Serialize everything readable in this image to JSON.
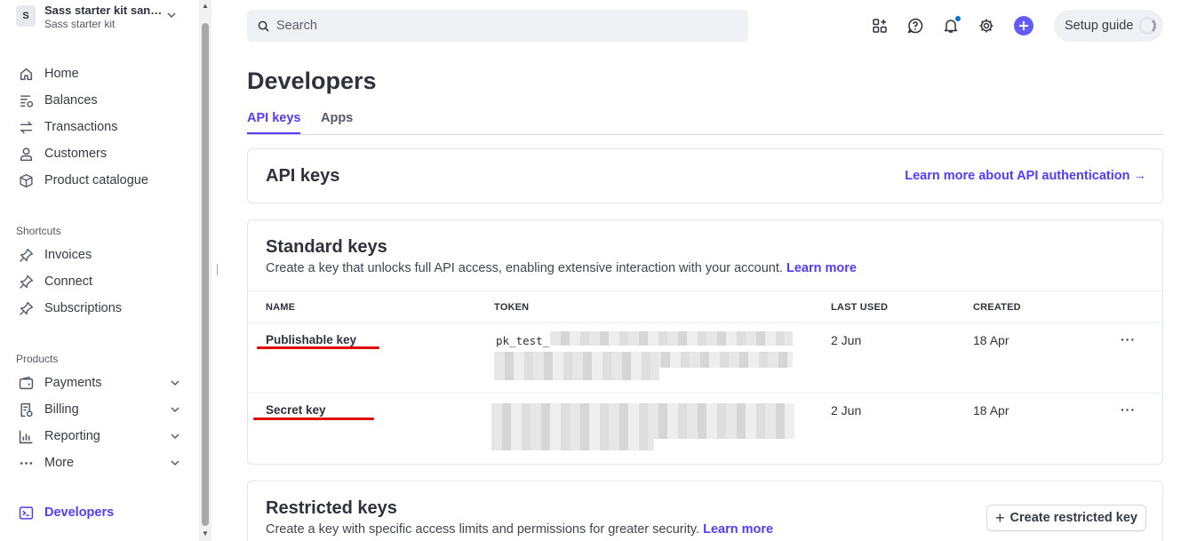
{
  "account": {
    "avatar": "S",
    "name": "Sass starter kit sand…",
    "subtitle": "Sass starter kit"
  },
  "nav": {
    "main": [
      {
        "label": "Home",
        "icon": "home-icon"
      },
      {
        "label": "Balances",
        "icon": "balances-icon"
      },
      {
        "label": "Transactions",
        "icon": "transactions-icon"
      },
      {
        "label": "Customers",
        "icon": "customers-icon"
      },
      {
        "label": "Product catalogue",
        "icon": "product-icon"
      }
    ],
    "shortcuts_label": "Shortcuts",
    "shortcuts": [
      {
        "label": "Invoices",
        "icon": "pin-icon"
      },
      {
        "label": "Connect",
        "icon": "pin-icon"
      },
      {
        "label": "Subscriptions",
        "icon": "pin-icon"
      }
    ],
    "products_label": "Products",
    "products": [
      {
        "label": "Payments",
        "icon": "payments-icon"
      },
      {
        "label": "Billing",
        "icon": "billing-icon"
      },
      {
        "label": "Reporting",
        "icon": "reporting-icon"
      },
      {
        "label": "More",
        "icon": "more-icon"
      }
    ],
    "developers": {
      "label": "Developers",
      "icon": "developers-icon"
    }
  },
  "search": {
    "placeholder": "Search"
  },
  "topbar": {
    "setup_label": "Setup guide",
    "accent": "#635bff"
  },
  "page": {
    "title": "Developers",
    "tabs": [
      {
        "label": "API keys",
        "active": true
      },
      {
        "label": "Apps",
        "active": false
      }
    ]
  },
  "api_keys_card": {
    "title": "API keys",
    "link": "Learn more about API authentication →"
  },
  "standard_keys": {
    "title": "Standard keys",
    "description": "Create a key that unlocks full API access, enabling extensive interaction with your account.",
    "learn_more": "Learn more",
    "columns": [
      "NAME",
      "TOKEN",
      "LAST USED",
      "CREATED"
    ],
    "rows": [
      {
        "name": "Publishable key",
        "token": "pk_test_",
        "last_used": "2 Jun",
        "created": "18 Apr",
        "more": "···"
      },
      {
        "name": "Secret key",
        "token": "",
        "last_used": "2 Jun",
        "created": "18 Apr",
        "more": "···"
      }
    ]
  },
  "restricted_keys": {
    "title": "Restricted keys",
    "description": "Create a key with specific access limits and permissions for greater security.",
    "learn_more": "Learn more",
    "create_button": "Create restricted key"
  }
}
